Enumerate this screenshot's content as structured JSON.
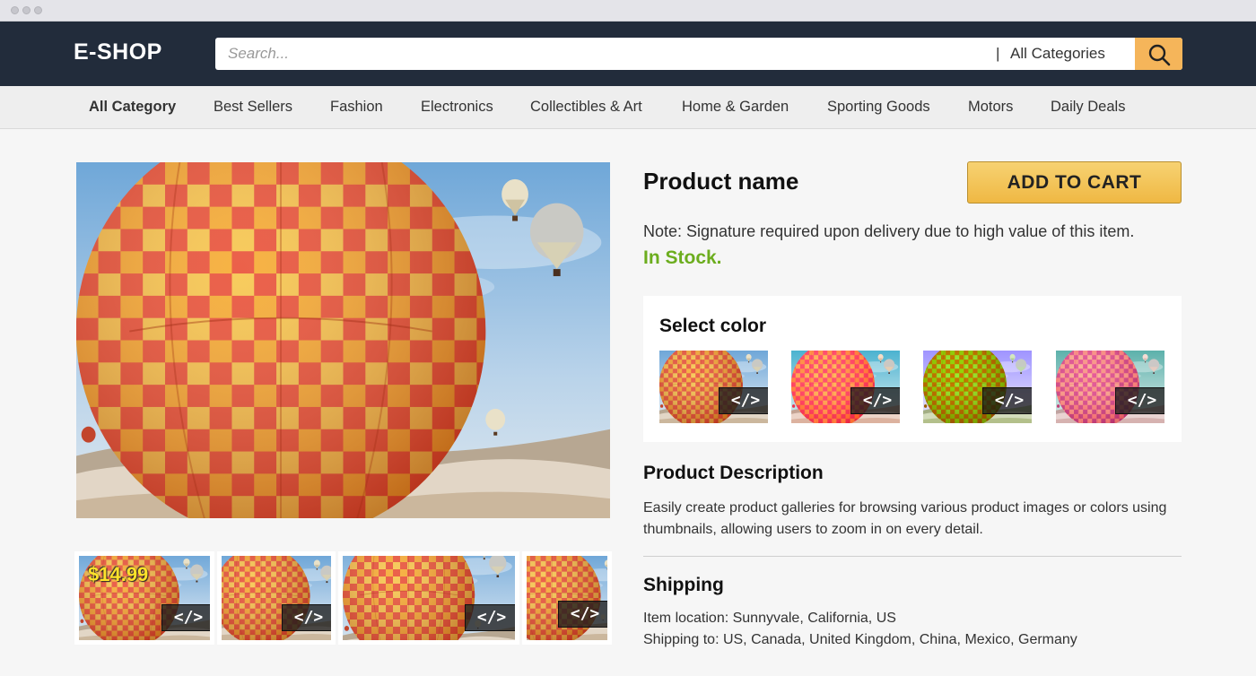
{
  "header": {
    "logo": "E-SHOP",
    "search_placeholder": "Search...",
    "category_separator": "|",
    "category_label": "All Categories",
    "search_icon": "search-icon"
  },
  "nav": {
    "items": [
      {
        "label": "All Category",
        "active": true
      },
      {
        "label": "Best Sellers"
      },
      {
        "label": "Fashion"
      },
      {
        "label": "Electronics"
      },
      {
        "label": "Collectibles & Art"
      },
      {
        "label": "Home & Garden"
      },
      {
        "label": "Sporting Goods"
      },
      {
        "label": "Motors"
      },
      {
        "label": "Daily Deals"
      }
    ]
  },
  "product": {
    "name": "Product name",
    "add_to_cart": "ADD TO CART",
    "note": "Note: Signature required upon delivery due to high value of this item.",
    "stock": "In Stock.",
    "price": "$14.99",
    "select_color_title": "Select color",
    "code_badge": "</>",
    "description_title": "Product Description",
    "description_text": "Easily create product galleries for browsing various product images or colors using thumbnails, allowing users to zoom in on every detail.",
    "shipping_title": "Shipping",
    "shipping_location": "Item location: Sunnyvale, California, US",
    "shipping_to": "Shipping to: US, Canada, United Kingdom, China, Mexico, Germany"
  },
  "colors": {
    "accent": "#f5b55a",
    "header_bg": "#222c3b",
    "stock_green": "#6cad1e"
  }
}
